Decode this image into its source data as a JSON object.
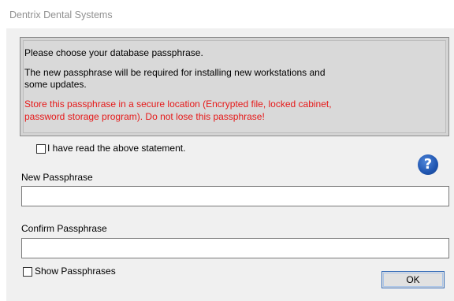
{
  "window": {
    "title": "Dentrix Dental Systems"
  },
  "info": {
    "line1": "Please choose your database passphrase.",
    "line2a": "The new passphrase will be required for installing new workstations and",
    "line2b": "some updates.",
    "warning_a": "Store this passphrase in a secure location (Encrypted file, locked cabinet,",
    "warning_b": "password storage program).  Do not lose this passphrase!"
  },
  "statement_checkbox": {
    "label": "I have read the above statement.",
    "checked": false
  },
  "new_passphrase": {
    "label": "New Passphrase",
    "value": ""
  },
  "confirm_passphrase": {
    "label": "Confirm Passphrase",
    "value": ""
  },
  "show_checkbox": {
    "label": "Show Passphrases",
    "checked": false
  },
  "buttons": {
    "ok_label": "OK"
  },
  "icons": {
    "help": "question-mark-circle-icon",
    "help_glyph": "?"
  },
  "colors": {
    "warning": "#e61919",
    "help_icon": "#1f55b0",
    "dialog_bg": "#f0f0f0"
  }
}
